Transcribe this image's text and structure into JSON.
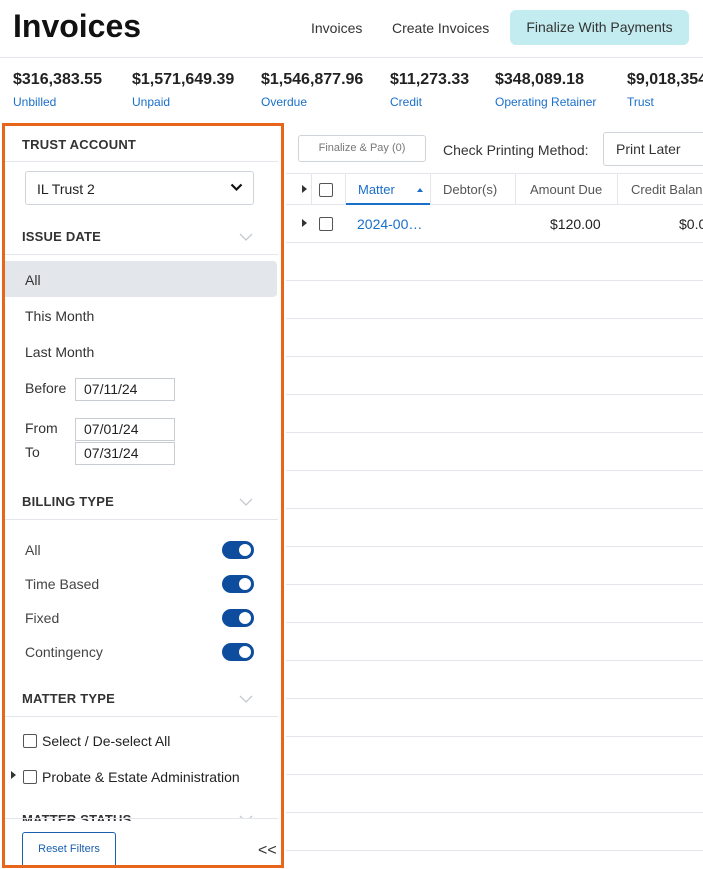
{
  "header": {
    "title": "Invoices",
    "nav": [
      "Invoices",
      "Create Invoices"
    ],
    "primary_action": "Finalize With Payments"
  },
  "summary": [
    {
      "amount": "$316,383.55",
      "label": "Unbilled"
    },
    {
      "amount": "$1,571,649.39",
      "label": "Unpaid"
    },
    {
      "amount": "$1,546,877.96",
      "label": "Overdue"
    },
    {
      "amount": "$11,273.33",
      "label": "Credit"
    },
    {
      "amount": "$348,089.18",
      "label": "Operating Retainer"
    },
    {
      "amount": "$9,018,354",
      "label": "Trust"
    }
  ],
  "sidebar": {
    "trust_account": {
      "title": "TRUST ACCOUNT",
      "selected": "IL Trust 2"
    },
    "issue_date": {
      "title": "ISSUE DATE",
      "options": [
        "All",
        "This Month",
        "Last Month"
      ],
      "selected": "All",
      "before_label": "Before",
      "before_value": "07/11/24",
      "from_label": "From",
      "from_value": "07/01/24",
      "to_label": "To",
      "to_value": "07/31/24"
    },
    "billing_type": {
      "title": "BILLING TYPE",
      "items": [
        {
          "label": "All",
          "on": true
        },
        {
          "label": "Time Based",
          "on": true
        },
        {
          "label": "Fixed",
          "on": true
        },
        {
          "label": "Contingency",
          "on": true
        }
      ]
    },
    "matter_type": {
      "title": "MATTER TYPE",
      "select_all": "Select / De-select All",
      "items": [
        "Probate & Estate Administration"
      ]
    },
    "matter_status": {
      "title": "MATTER STATUS"
    },
    "reset_label": "Reset Filters",
    "collapse_glyph": "<<"
  },
  "toolbar": {
    "finalize_pay": "Finalize & Pay (0)",
    "check_printing_label": "Check Printing Method:",
    "check_printing_value": "Print Later"
  },
  "grid": {
    "columns": [
      "Matter",
      "Debtor(s)",
      "Amount Due",
      "Credit Balan"
    ],
    "sorted_column": "Matter",
    "rows": [
      {
        "matter": "2024-00…",
        "debtors": "",
        "amount_due": "$120.00",
        "credit_balance": "$0.0"
      }
    ]
  },
  "colors": {
    "accent": "#1a6fc9",
    "highlight_border": "#e8661c",
    "toggle_on": "#0e4d9e",
    "primary_button_bg": "#c3ecf0"
  }
}
